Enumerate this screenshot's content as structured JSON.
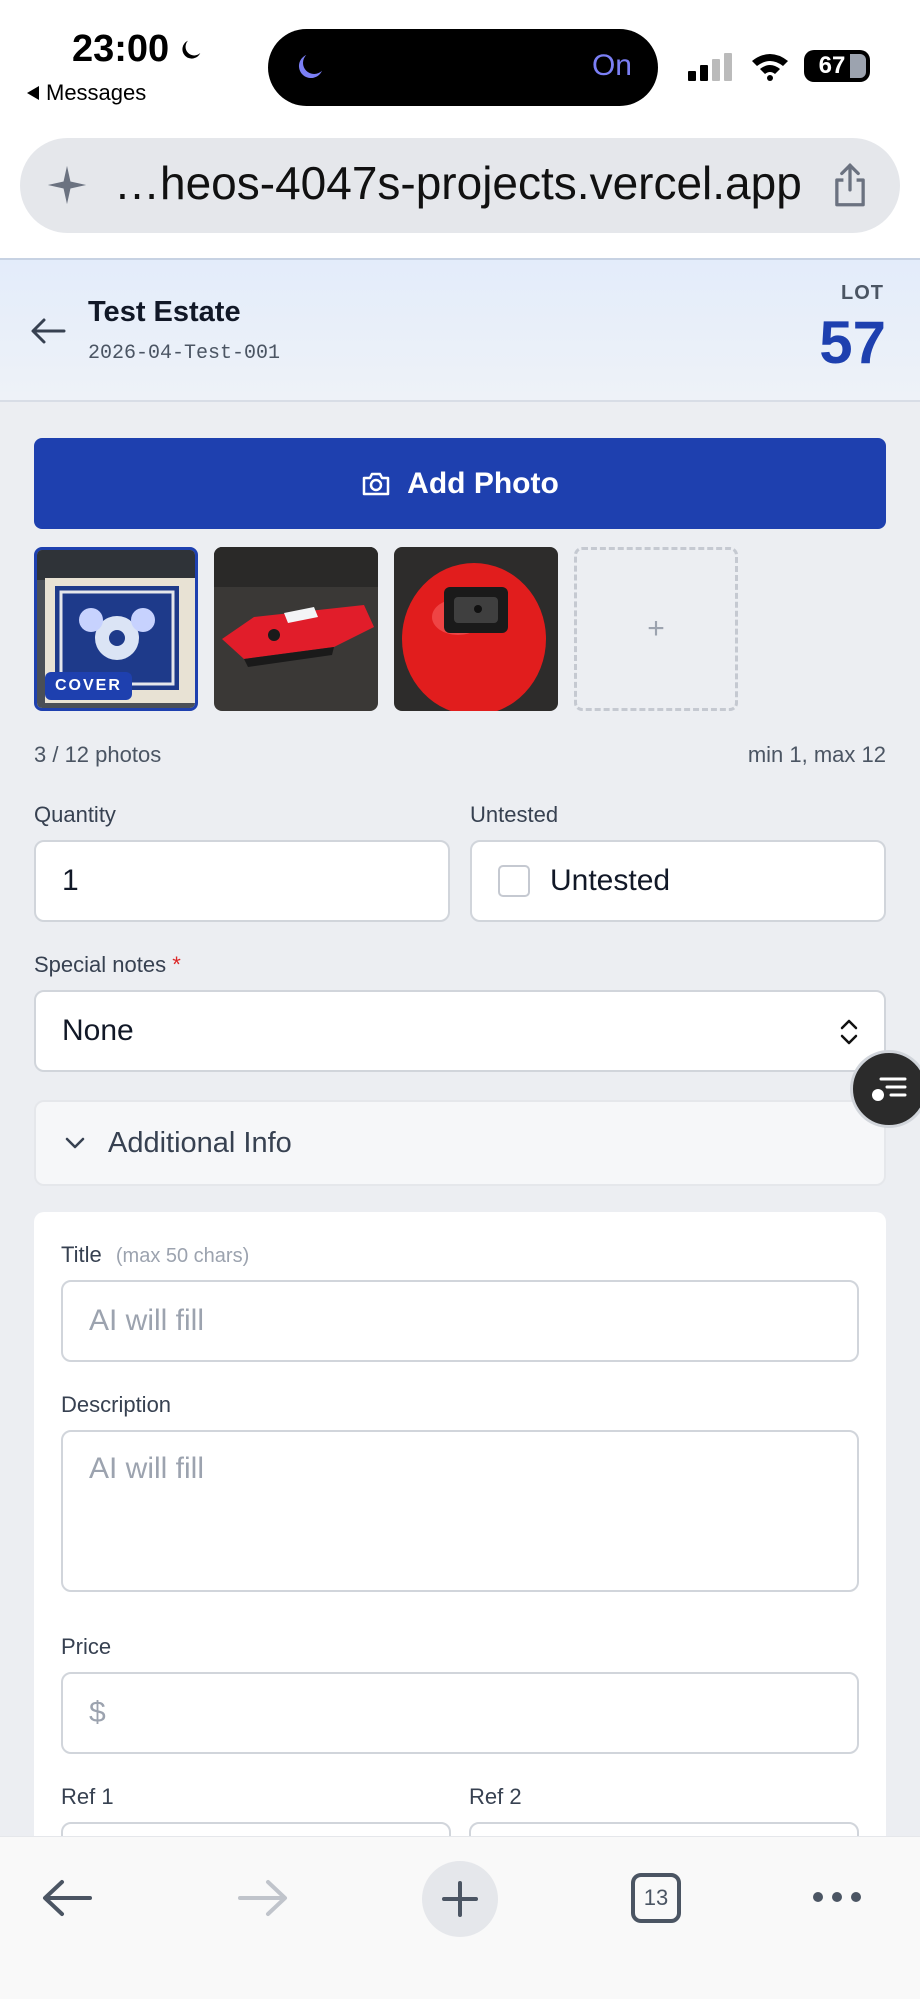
{
  "status_bar": {
    "time": "23:00",
    "back_label": "Messages",
    "focus_mode": "On",
    "battery": "67"
  },
  "browser": {
    "url": "…heos-4047s-projects.vercel.app",
    "tab_count": "13"
  },
  "header": {
    "title": "Test Estate",
    "subtitle": "2026-04-Test-001",
    "lot_label": "LOT",
    "lot_number": "57"
  },
  "photos": {
    "add_button": "Add Photo",
    "cover_badge": "COVER",
    "add_tile": "+",
    "count_text": "3 / 12 photos",
    "limit_text": "min 1, max 12"
  },
  "form": {
    "quantity_label": "Quantity",
    "quantity_value": "1",
    "untested_label": "Untested",
    "untested_checkbox_label": "Untested",
    "special_notes_label": "Special notes",
    "required_mark": "*",
    "special_notes_value": "None",
    "additional_info_label": "Additional Info",
    "title_label": "Title",
    "title_hint": "(max 50 chars)",
    "title_placeholder": "AI will fill",
    "description_label": "Description",
    "description_placeholder": "AI will fill",
    "price_label": "Price",
    "price_placeholder": "$",
    "ref1_label": "Ref 1",
    "ref2_label": "Ref 2"
  },
  "colors": {
    "accent": "#1e40af",
    "required": "#dc2626"
  }
}
